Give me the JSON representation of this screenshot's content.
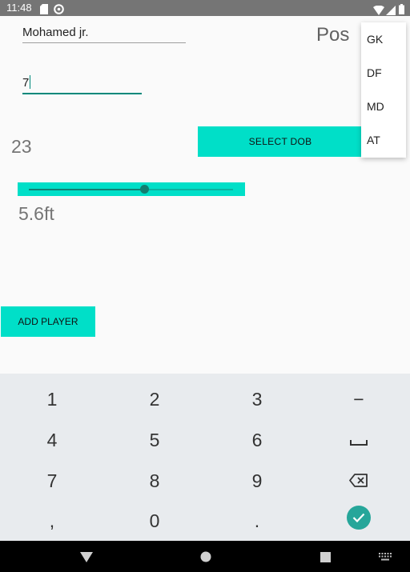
{
  "status_bar": {
    "time": "11:48",
    "icons": [
      "sd-card-icon",
      "sync-icon",
      "wifi-icon",
      "signal-icon",
      "battery-icon"
    ]
  },
  "form": {
    "name_value": "Mohamed jr.",
    "number_value": "7",
    "pos_label": "Pos",
    "age_value": "23",
    "select_dob_label": "SELECT DOB",
    "height_label": "5.6ft",
    "height_slider_fraction": 0.565,
    "add_player_label": "ADD PLAYER"
  },
  "position_dropdown": {
    "options": [
      "GK",
      "DF",
      "MD",
      "AT"
    ]
  },
  "keyboard": {
    "keys": [
      [
        "1",
        "2",
        "3",
        "−"
      ],
      [
        "4",
        "5",
        "6",
        "space-icon"
      ],
      [
        "7",
        "8",
        "9",
        "backspace-icon"
      ],
      [
        ",",
        "0",
        ".",
        "enter-icon"
      ]
    ]
  },
  "nav_bar": {
    "buttons": [
      "back-icon",
      "home-icon",
      "recents-icon",
      "keyboard-switch-icon"
    ]
  },
  "colors": {
    "accent": "#00dfc8",
    "field_focus": "#00897b",
    "enter_key": "#26a69a",
    "status_bar": "#757575",
    "keyboard_bg": "#e8ebee"
  }
}
